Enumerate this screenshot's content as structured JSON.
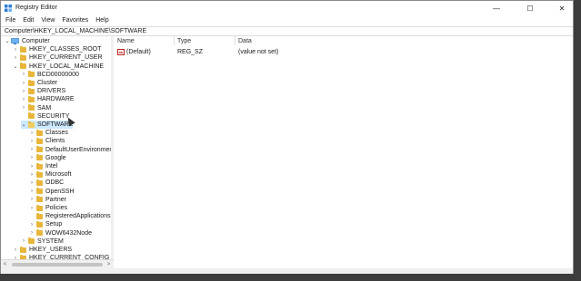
{
  "window": {
    "title": "Registry Editor"
  },
  "window_controls": {
    "minimize": "—",
    "maximize": "☐",
    "close": "✕"
  },
  "menu": [
    "File",
    "Edit",
    "View",
    "Favorites",
    "Help"
  ],
  "address": "Computer\\HKEY_LOCAL_MACHINE\\SOFTWARE",
  "tree": [
    {
      "label": "Computer",
      "chev": "v",
      "icon": "computer"
    },
    {
      "label": "HKEY_CLASSES_ROOT",
      "chev": ">"
    },
    {
      "label": "HKEY_CURRENT_USER",
      "chev": ">"
    },
    {
      "label": "HKEY_LOCAL_MACHINE",
      "chev": "v"
    },
    {
      "label": "BCD00000000",
      "chev": ">"
    },
    {
      "label": "Cluster",
      "chev": ">"
    },
    {
      "label": "DRIVERS",
      "chev": ">"
    },
    {
      "label": "HARDWARE",
      "chev": ">"
    },
    {
      "label": "SAM",
      "chev": ">"
    },
    {
      "label": "SECURITY",
      "chev": ""
    },
    {
      "label": "SOFTWARE",
      "chev": "v",
      "selected": true
    },
    {
      "label": "Classes",
      "chev": ">"
    },
    {
      "label": "Clients",
      "chev": ">"
    },
    {
      "label": "DefaultUserEnvironment",
      "chev": ">"
    },
    {
      "label": "Google",
      "chev": ">"
    },
    {
      "label": "Intel",
      "chev": ">"
    },
    {
      "label": "Microsoft",
      "chev": ">"
    },
    {
      "label": "ODBC",
      "chev": ">"
    },
    {
      "label": "OpenSSH",
      "chev": ">"
    },
    {
      "label": "Partner",
      "chev": ">"
    },
    {
      "label": "Policies",
      "chev": ">"
    },
    {
      "label": "RegisteredApplications",
      "chev": ""
    },
    {
      "label": "Setup",
      "chev": ">"
    },
    {
      "label": "WOW6432Node",
      "chev": ">"
    },
    {
      "label": "SYSTEM",
      "chev": ">"
    },
    {
      "label": "HKEY_USERS",
      "chev": ">"
    },
    {
      "label": "HKEY_CURRENT_CONFIG",
      "chev": ">"
    }
  ],
  "columns": {
    "name": "Name",
    "type": "Type",
    "data": "Data"
  },
  "values": [
    {
      "name": "(Default)",
      "type": "REG_SZ",
      "data": "(value not set)",
      "icon_text": "ab"
    }
  ],
  "scroll": {
    "left": "<",
    "right": ">"
  },
  "colors": {
    "folder": "#e8b63a",
    "selection": "#cce8ff"
  }
}
